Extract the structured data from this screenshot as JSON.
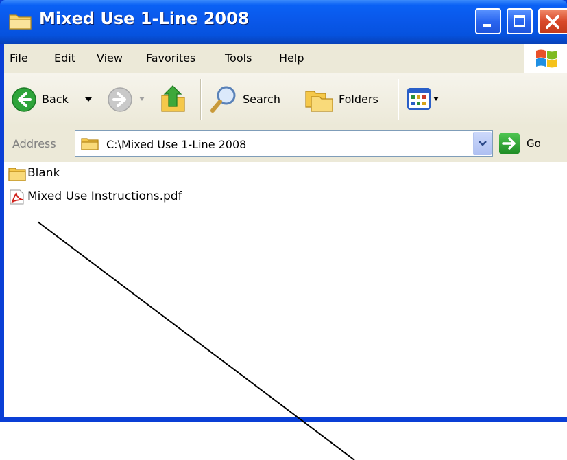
{
  "window": {
    "title": "Mixed Use 1-Line 2008"
  },
  "menu": [
    "File",
    "Edit",
    "View",
    "Favorites",
    "Tools",
    "Help"
  ],
  "toolbar": {
    "back_label": "Back",
    "search_label": "Search",
    "folders_label": "Folders"
  },
  "address": {
    "label": "Address",
    "value": "C:\\Mixed Use 1-Line 2008",
    "go_label": "Go"
  },
  "files": [
    {
      "name": "Blank",
      "icon": "folder-icon"
    },
    {
      "name": "Mixed Use Instructions.pdf",
      "icon": "pdf-icon"
    }
  ],
  "colors": {
    "titlebar": "#0a58ea",
    "chrome": "#ece9d8",
    "close_button": "#d9492a",
    "go_button": "#2e9e33"
  }
}
